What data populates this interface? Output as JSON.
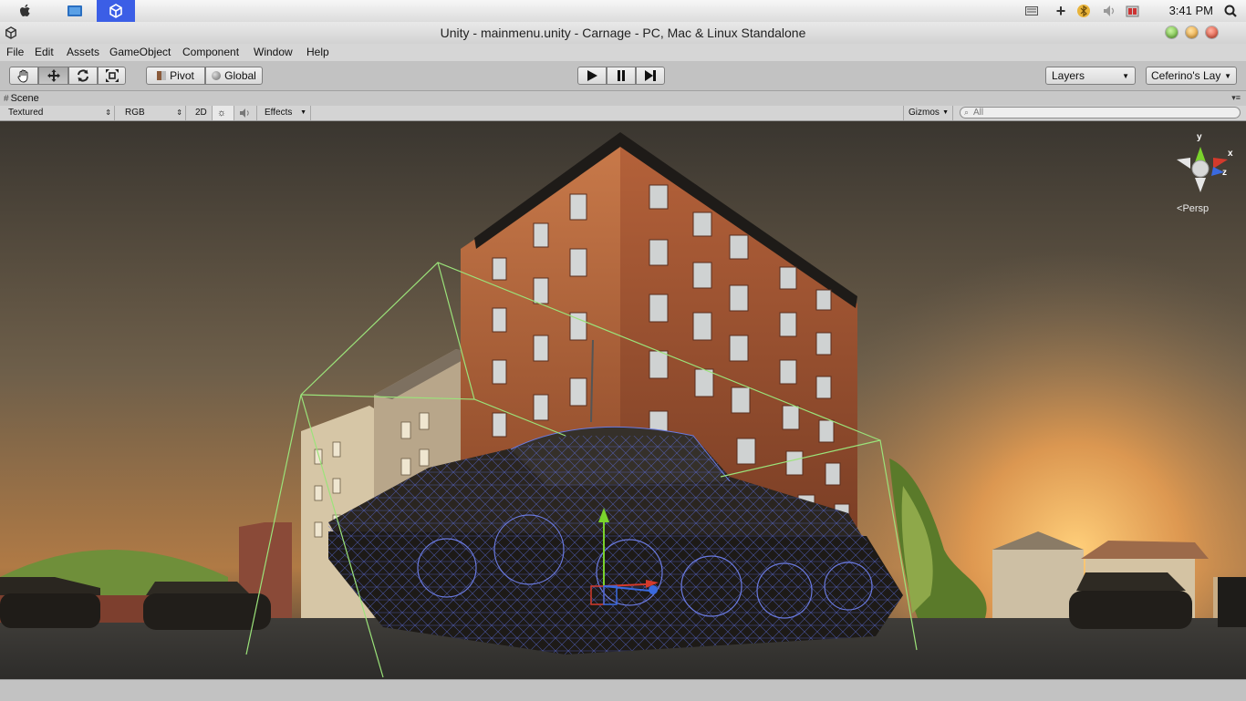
{
  "os": {
    "clock": "3:41 PM",
    "icons": [
      "apple-icon",
      "finder-icon",
      "unity-icon",
      "keyboard-icon",
      "plus-icon",
      "bluetooth-icon",
      "volume-icon",
      "battery-icon",
      "search-icon"
    ]
  },
  "window": {
    "title": "Unity - mainmenu.unity - Carnage - PC, Mac & Linux Standalone"
  },
  "menu": [
    "File",
    "Edit",
    "Assets",
    "GameObject",
    "Component",
    "Window",
    "Help"
  ],
  "toolbar": {
    "pivot": "Pivot",
    "global": "Global",
    "layers": "Layers",
    "layout": "Ceferino's Lay"
  },
  "scene": {
    "tab_label": "Scene",
    "render_mode": "Textured",
    "color_mode": "RGB",
    "toggle_2d": "2D",
    "effects": "Effects",
    "gizmos": "Gizmos",
    "search_placeholder": "All",
    "persp": "Persp",
    "axis_x": "x",
    "axis_y": "y",
    "axis_z": "z"
  },
  "colors": {
    "accent_play_selected": "#3a6ae0",
    "gizmo_x": "#d33a2c",
    "gizmo_y": "#7ad32c",
    "gizmo_z": "#3a6ae0",
    "bounds": "#9be37a"
  }
}
